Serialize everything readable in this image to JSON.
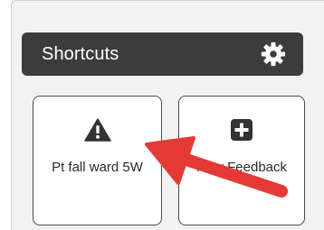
{
  "shortcuts": {
    "title": "Shortcuts",
    "settings_icon": "gear-icon",
    "tiles": [
      {
        "label": "Pt fall ward 5W",
        "icon": "warning-triangle-icon"
      },
      {
        "label": "New Feedback",
        "icon": "plus-square-icon"
      }
    ]
  },
  "annotation": {
    "icon": "red-arrow-icon",
    "color": "#e53935"
  },
  "colors": {
    "header_bg": "#3c3c3c",
    "panel_bg": "#f2f2f2",
    "tile_border": "#4a4a4a"
  }
}
